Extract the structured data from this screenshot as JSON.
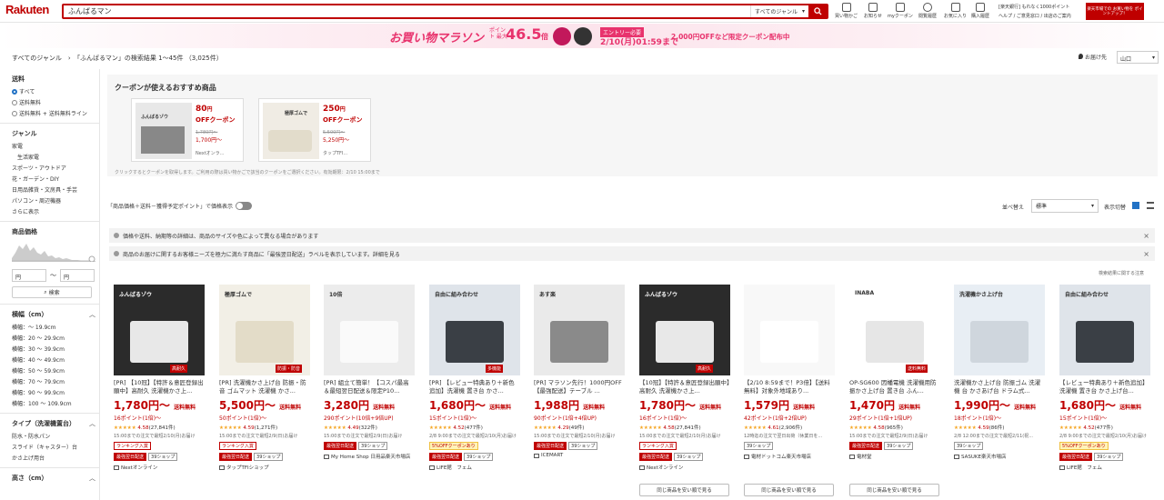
{
  "header": {
    "logo": "Rakuten",
    "search_value": "ふんばるマン",
    "genre_select": "すべてのジャンル",
    "nav": [
      "買い物かご",
      "お知らせ",
      "myクーポン",
      "閲覧履歴",
      "お気に入り",
      "購入履歴"
    ],
    "right_links": "[楽天銀行] もれなく1000ポイント",
    "right_links2": "ヘルプ / ご意見窓口 / 出店のご案内",
    "promo_badge": "楽天市場での お買い物を ポイントアップ！"
  },
  "banner": {
    "title": "お買い物マラソン",
    "point_label": "ポイント 最大",
    "point_value": "46.5",
    "point_unit": "倍",
    "entry": "エントリー必要",
    "deadline": "2/10(月)01:59まで",
    "coupon": "2,000円OFFなど限定クーポン配布中"
  },
  "breadcrumb": "すべてのジャンル　›　「ふんばるマン」の検索結果 1～45件 （3,025件）",
  "location": {
    "label": "お届け先",
    "value": "山口"
  },
  "sidebar": {
    "shipping_title": "送料",
    "shipping_options": [
      "すべて",
      "送料無料",
      "送料無料 + 送料無料ライン"
    ],
    "genre_title": "ジャンル",
    "genres": [
      "家電",
      "生活家電",
      "スポーツ・アウトドア",
      "花・ガーデン・DIY",
      "日用品雑貨・文房具・手芸",
      "パソコン・周辺機器",
      "さらに表示"
    ],
    "price_title": "商品価格",
    "price_min": "円",
    "price_max": "円",
    "price_button": "検索",
    "width_title": "横幅（cm）",
    "widths": [
      "横幅：～ 19.9cm",
      "横幅：20 ～ 29.9cm",
      "横幅：30 ～ 39.9cm",
      "横幅：40 ～ 49.9cm",
      "横幅：50 ～ 59.9cm",
      "横幅：70 ～ 79.9cm",
      "横幅：90 ～ 99.9cm",
      "横幅：100 ～ 109.9cm"
    ],
    "type_title": "タイプ（洗濯機置台）",
    "types": [
      "防水・防水パン",
      "スライド（キャスター）台",
      "かさ上げ用台"
    ],
    "height_title": "高さ（cm）"
  },
  "coupons": {
    "title": "クーポンが使えるおすすめ商品",
    "items": [
      {
        "amount": "80",
        "unit": "円",
        "label": "OFFクーポン",
        "before": "1,780円～",
        "after": "1,700円～",
        "shop": "Nextオンラ..."
      },
      {
        "amount": "250",
        "unit": "円",
        "label": "OFFクーポン",
        "before": "5,500円～",
        "after": "5,250円～",
        "shop": "タップTFI..."
      }
    ],
    "note": "クリックするとクーポンを取得します。ご利用の際は買い物かごで該当のクーポンをご選択ください。有効期限：2/10 15:00まで"
  },
  "toolbar": {
    "price_toggle": "「商品価格＋送料－獲得予定ポイント」で価格表示",
    "sort_label": "並べ替え",
    "sort_value": "標準",
    "view_label": "表示切替"
  },
  "notices": [
    "価格や送料、納期等の詳細は、商品のサイズや色によって異なる場合があります",
    "商品のお届けに関するお客様ニーズを極力に満たす商品に「最強翌日配送」ラベルを表示しています。詳細を見る"
  ],
  "related_note": "検索結果に関する注意",
  "colors": {
    "brand": "#bf0000",
    "accent_pink": "#e8336d",
    "star": "#f5a623",
    "link": "#2272c5"
  },
  "products": [
    {
      "title": "[PR] 【10冠】【特許＆意匠登録出願中】高耐久 洗濯機かさ上...",
      "price": "1,780円～",
      "fs": "送料無料",
      "points": "16ポイント(1倍)～",
      "rating": "4.58",
      "reviews": "(27,841件)",
      "delivery": "15:00までの注文で最短2/10(月)お届け",
      "tags": [
        "ランキング入賞"
      ],
      "tags2": [
        "最強翌日配送",
        "39ショップ"
      ],
      "shop": "Nextオンライン"
    },
    {
      "title": "[PR] 洗濯機かさ上げ台 防振・防音 ゴムマット 洗濯機 かさ...",
      "price": "5,500円～",
      "fs": "送料無料",
      "points": "50ポイント(1倍)～",
      "rating": "4.59",
      "reviews": "(1,271件)",
      "delivery": "15:00までの注文で最短2/9(日)お届け",
      "tags": [
        "ランキング入賞"
      ],
      "tags2": [
        "最強翌日配送",
        "39ショップ"
      ],
      "shop": "タップTFIショップ"
    },
    {
      "title": "[PR] 組立て簡単！【コスパ最高＆最短翌日配送＆限定P10...",
      "price": "3,280円",
      "fs": "送料無料",
      "points": "290ポイント(10倍+9倍UP)",
      "rating": "4.49",
      "reviews": "(322件)",
      "delivery": "15:00までの注文で最短2/9(日)お届け",
      "tags": [],
      "tags2": [
        "最強翌日配送",
        "39ショップ"
      ],
      "shop": "My Home Shop 日用品楽天市場店"
    },
    {
      "title": "[PR] 【レビュー特典あり＋新色追加】洗濯機 置き台 かさ...",
      "price": "1,680円～",
      "fs": "送料無料",
      "points": "15ポイント(1倍)～",
      "rating": "4.52",
      "reviews": "(477件)",
      "delivery": "2/8 9:00までの注文で最短2/10(月)お届け",
      "tags": [
        "5%OFFクーポンあり"
      ],
      "tags2": [
        "最強翌日配送",
        "39ショップ"
      ],
      "shop": "LIFE館　フェム"
    },
    {
      "title": "[PR] マラソン先行！1000円OFF【最強配送】テーブル ...",
      "price": "1,988円",
      "fs": "送料無料",
      "points": "90ポイント(1倍+4倍UP)",
      "rating": "4.29",
      "reviews": "(49件)",
      "delivery": "15:00までの注文で最短2/10(月)お届け",
      "tags": [],
      "tags2": [
        "最強翌日配送",
        "39ショップ"
      ],
      "shop": "ICEMART"
    },
    {
      "title": "【10冠】【特許＆意匠登録出願中】高耐久 洗濯機かさ上...",
      "price": "1,780円～",
      "fs": "送料無料",
      "points": "16ポイント(1倍)～",
      "rating": "4.58",
      "reviews": "(27,841件)",
      "delivery": "15:00までの注文で最短2/10(月)お届け",
      "tags": [
        "ランキング入賞"
      ],
      "tags2": [
        "最強翌日配送",
        "39ショップ"
      ],
      "shop": "Nextオンライン"
    },
    {
      "title": "【2/10 8:59まで！P3倍】【送料無料】対象外地域あり...",
      "price": "1,579円",
      "fs": "送料無料",
      "points": "42ポイント(1倍+2倍UP)",
      "rating": "4.61",
      "reviews": "(2,906件)",
      "delivery": "12時迄の注文で翌日出荷（休業日を...",
      "tags": [],
      "tags2": [
        "39ショップ"
      ],
      "shop": "電材ドットコム楽天市場店"
    },
    {
      "title": "OP-SG600 因幡電機 洗濯機用防振かさ上げ台 置き台 ふん...",
      "price": "1,470円",
      "fs": "送料無料",
      "points": "29ポイント(1倍+1倍UP)",
      "rating": "4.58",
      "reviews": "(965件)",
      "delivery": "15:00までの注文で最短2/9(日)お届け",
      "tags": [],
      "tags2": [
        "最強翌日配送",
        "39ショップ"
      ],
      "shop": "電材堂"
    },
    {
      "title": "洗濯機かさ上げ台 防振ゴム 洗濯機 台 かさあげ台 ドラム式...",
      "price": "1,990円～",
      "fs": "送料無料",
      "points": "18ポイント(1倍)～",
      "rating": "4.59",
      "reviews": "(86件)",
      "delivery": "2/8 12:00までの注文で最短2/11(祝...",
      "tags": [],
      "tags2": [
        "39ショップ"
      ],
      "shop": "SASUKE楽天市場店"
    },
    {
      "title": "【レビュー特典あり＋新色追加】洗濯機 置き台 かさ上げ台...",
      "price": "1,680円～",
      "fs": "送料無料",
      "points": "15ポイント(1倍)～",
      "rating": "4.52",
      "reviews": "(477件)",
      "delivery": "2/8 9:00までの注文で最短2/10(月)お届け",
      "tags": [
        "5%OFFクーポンあり"
      ],
      "tags2": [
        "最強翌日配送",
        "39ショップ"
      ],
      "shop": "LIFE館　フェム"
    }
  ],
  "same_button": "同じ商品を安い順で見る",
  "thumb_labels": {
    "p0": "ふんばるゾウ",
    "p0b": "防振",
    "p0c": "防音",
    "p0d": "高耐久",
    "p1": "極厚ゴムで",
    "p1b": "防振・防音",
    "p2": "10倍",
    "p3": "自由に組み合わせ",
    "p3b": "多機能",
    "p4": "あす楽",
    "p7": "送料無料",
    "p7b": "INABA",
    "p8": "洗濯機かさ上げ台",
    "p9": "自由に組み合わせ"
  }
}
